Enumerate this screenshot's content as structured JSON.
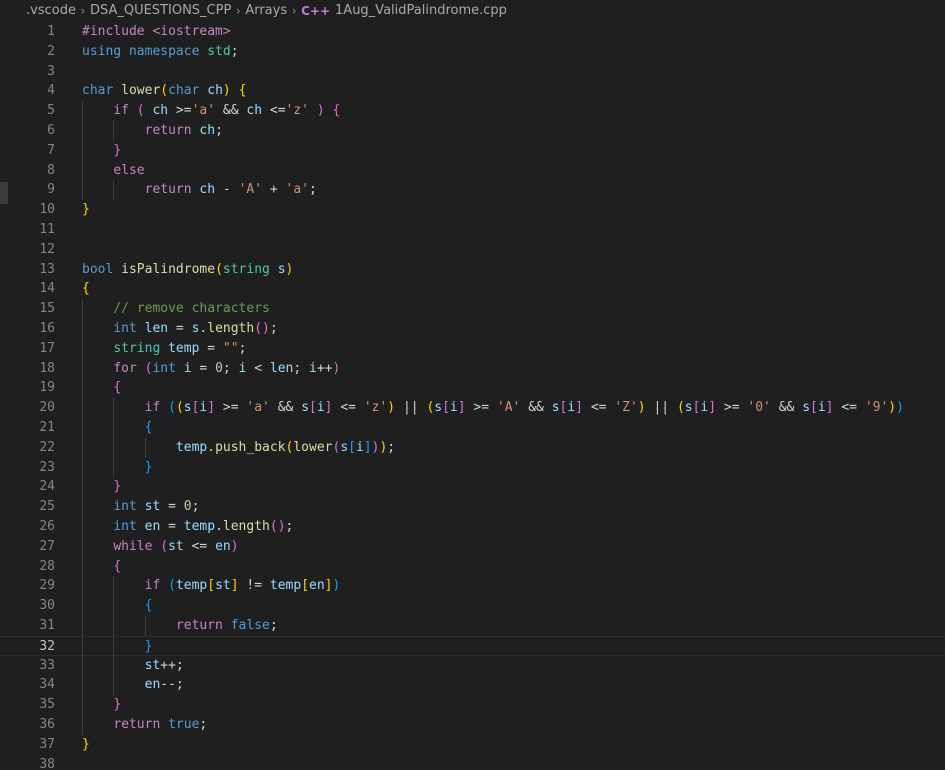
{
  "breadcrumb": {
    "items": [
      ".vscode",
      "DSA_QUESTIONS_CPP",
      "Arrays",
      "1Aug_ValidPalindrome.cpp"
    ],
    "separator": "›",
    "file_icon": "C++"
  },
  "editor": {
    "active_line": 32,
    "lines": [
      [
        [
          "#include <iostream>",
          "ctl"
        ]
      ],
      [
        [
          "using",
          "kw"
        ],
        [
          " ",
          "plain"
        ],
        [
          "namespace",
          "kw"
        ],
        [
          " ",
          "plain"
        ],
        [
          "std",
          "type"
        ],
        [
          ";",
          "plain"
        ]
      ],
      [],
      [
        [
          "char",
          "kw"
        ],
        [
          " ",
          "plain"
        ],
        [
          "lower",
          "fn"
        ],
        [
          "(",
          "br1"
        ],
        [
          "char",
          "kw"
        ],
        [
          " ",
          "plain"
        ],
        [
          "ch",
          "var"
        ],
        [
          ")",
          "br1"
        ],
        [
          " ",
          "plain"
        ],
        [
          "{",
          "br1"
        ]
      ],
      [
        [
          "    ",
          "plain"
        ],
        [
          "if",
          "ctl"
        ],
        [
          " ",
          "plain"
        ],
        [
          "(",
          "br2"
        ],
        [
          " ",
          "plain"
        ],
        [
          "ch",
          "var"
        ],
        [
          " >=",
          "plain"
        ],
        [
          "'a'",
          "str"
        ],
        [
          " && ",
          "plain"
        ],
        [
          "ch",
          "var"
        ],
        [
          " <=",
          "plain"
        ],
        [
          "'z'",
          "str"
        ],
        [
          " ",
          "plain"
        ],
        [
          ")",
          "br2"
        ],
        [
          " ",
          "plain"
        ],
        [
          "{",
          "br2"
        ]
      ],
      [
        [
          "        ",
          "plain"
        ],
        [
          "return",
          "ctl"
        ],
        [
          " ",
          "plain"
        ],
        [
          "ch",
          "var"
        ],
        [
          ";",
          "plain"
        ]
      ],
      [
        [
          "    ",
          "plain"
        ],
        [
          "}",
          "br2"
        ]
      ],
      [
        [
          "    ",
          "plain"
        ],
        [
          "else",
          "ctl"
        ]
      ],
      [
        [
          "        ",
          "plain"
        ],
        [
          "return",
          "ctl"
        ],
        [
          " ",
          "plain"
        ],
        [
          "ch",
          "var"
        ],
        [
          " - ",
          "plain"
        ],
        [
          "'A'",
          "str"
        ],
        [
          " + ",
          "plain"
        ],
        [
          "'a'",
          "str"
        ],
        [
          ";",
          "plain"
        ]
      ],
      [
        [
          "}",
          "br1"
        ]
      ],
      [],
      [],
      [
        [
          "bool",
          "kw"
        ],
        [
          " ",
          "plain"
        ],
        [
          "isPalindrome",
          "fn"
        ],
        [
          "(",
          "br1"
        ],
        [
          "string",
          "type"
        ],
        [
          " ",
          "plain"
        ],
        [
          "s",
          "var"
        ],
        [
          ")",
          "br1"
        ]
      ],
      [
        [
          "{",
          "br1"
        ]
      ],
      [
        [
          "    ",
          "plain"
        ],
        [
          "// remove characters",
          "cmt"
        ]
      ],
      [
        [
          "    ",
          "plain"
        ],
        [
          "int",
          "kw"
        ],
        [
          " ",
          "plain"
        ],
        [
          "len",
          "var"
        ],
        [
          " = ",
          "plain"
        ],
        [
          "s",
          "var"
        ],
        [
          ".",
          "plain"
        ],
        [
          "length",
          "fn"
        ],
        [
          "()",
          "br2"
        ],
        [
          ";",
          "plain"
        ]
      ],
      [
        [
          "    ",
          "plain"
        ],
        [
          "string",
          "type"
        ],
        [
          " ",
          "plain"
        ],
        [
          "temp",
          "var"
        ],
        [
          " = ",
          "plain"
        ],
        [
          "\"\"",
          "str"
        ],
        [
          ";",
          "plain"
        ]
      ],
      [
        [
          "    ",
          "plain"
        ],
        [
          "for",
          "ctl"
        ],
        [
          " ",
          "plain"
        ],
        [
          "(",
          "br2"
        ],
        [
          "int",
          "kw"
        ],
        [
          " ",
          "plain"
        ],
        [
          "i",
          "var"
        ],
        [
          " = ",
          "plain"
        ],
        [
          "0",
          "num"
        ],
        [
          "; ",
          "plain"
        ],
        [
          "i",
          "var"
        ],
        [
          " < ",
          "plain"
        ],
        [
          "len",
          "var"
        ],
        [
          "; ",
          "plain"
        ],
        [
          "i",
          "var"
        ],
        [
          "++",
          "plain"
        ],
        [
          ")",
          "br2"
        ]
      ],
      [
        [
          "    ",
          "plain"
        ],
        [
          "{",
          "br2"
        ]
      ],
      [
        [
          "        ",
          "plain"
        ],
        [
          "if",
          "ctl"
        ],
        [
          " ",
          "plain"
        ],
        [
          "(",
          "br3"
        ],
        [
          "(",
          "br1"
        ],
        [
          "s",
          "var"
        ],
        [
          "[",
          "br2"
        ],
        [
          "i",
          "var"
        ],
        [
          "]",
          "br2"
        ],
        [
          " >= ",
          "plain"
        ],
        [
          "'a'",
          "str"
        ],
        [
          " && ",
          "plain"
        ],
        [
          "s",
          "var"
        ],
        [
          "[",
          "br2"
        ],
        [
          "i",
          "var"
        ],
        [
          "]",
          "br2"
        ],
        [
          " <= ",
          "plain"
        ],
        [
          "'z'",
          "str"
        ],
        [
          ")",
          "br1"
        ],
        [
          " || ",
          "plain"
        ],
        [
          "(",
          "br1"
        ],
        [
          "s",
          "var"
        ],
        [
          "[",
          "br2"
        ],
        [
          "i",
          "var"
        ],
        [
          "]",
          "br2"
        ],
        [
          " >= ",
          "plain"
        ],
        [
          "'A'",
          "str"
        ],
        [
          " && ",
          "plain"
        ],
        [
          "s",
          "var"
        ],
        [
          "[",
          "br2"
        ],
        [
          "i",
          "var"
        ],
        [
          "]",
          "br2"
        ],
        [
          " <= ",
          "plain"
        ],
        [
          "'Z'",
          "str"
        ],
        [
          ")",
          "br1"
        ],
        [
          " || ",
          "plain"
        ],
        [
          "(",
          "br1"
        ],
        [
          "s",
          "var"
        ],
        [
          "[",
          "br2"
        ],
        [
          "i",
          "var"
        ],
        [
          "]",
          "br2"
        ],
        [
          " >= ",
          "plain"
        ],
        [
          "'0'",
          "str"
        ],
        [
          " && ",
          "plain"
        ],
        [
          "s",
          "var"
        ],
        [
          "[",
          "br2"
        ],
        [
          "i",
          "var"
        ],
        [
          "]",
          "br2"
        ],
        [
          " <= ",
          "plain"
        ],
        [
          "'9'",
          "str"
        ],
        [
          ")",
          "br1"
        ],
        [
          ")",
          "br3"
        ]
      ],
      [
        [
          "        ",
          "plain"
        ],
        [
          "{",
          "br3"
        ]
      ],
      [
        [
          "            ",
          "plain"
        ],
        [
          "temp",
          "var"
        ],
        [
          ".",
          "plain"
        ],
        [
          "push_back",
          "fn"
        ],
        [
          "(",
          "br1"
        ],
        [
          "lower",
          "fn"
        ],
        [
          "(",
          "br2"
        ],
        [
          "s",
          "var"
        ],
        [
          "[",
          "br3"
        ],
        [
          "i",
          "var"
        ],
        [
          "]",
          "br3"
        ],
        [
          ")",
          "br2"
        ],
        [
          ")",
          "br1"
        ],
        [
          ";",
          "plain"
        ]
      ],
      [
        [
          "        ",
          "plain"
        ],
        [
          "}",
          "br3"
        ]
      ],
      [
        [
          "    ",
          "plain"
        ],
        [
          "}",
          "br2"
        ]
      ],
      [
        [
          "    ",
          "plain"
        ],
        [
          "int",
          "kw"
        ],
        [
          " ",
          "plain"
        ],
        [
          "st",
          "var"
        ],
        [
          " = ",
          "plain"
        ],
        [
          "0",
          "num"
        ],
        [
          ";",
          "plain"
        ]
      ],
      [
        [
          "    ",
          "plain"
        ],
        [
          "int",
          "kw"
        ],
        [
          " ",
          "plain"
        ],
        [
          "en",
          "var"
        ],
        [
          " = ",
          "plain"
        ],
        [
          "temp",
          "var"
        ],
        [
          ".",
          "plain"
        ],
        [
          "length",
          "fn"
        ],
        [
          "()",
          "br2"
        ],
        [
          ";",
          "plain"
        ]
      ],
      [
        [
          "    ",
          "plain"
        ],
        [
          "while",
          "ctl"
        ],
        [
          " ",
          "plain"
        ],
        [
          "(",
          "br2"
        ],
        [
          "st",
          "var"
        ],
        [
          " <= ",
          "plain"
        ],
        [
          "en",
          "var"
        ],
        [
          ")",
          "br2"
        ]
      ],
      [
        [
          "    ",
          "plain"
        ],
        [
          "{",
          "br2"
        ]
      ],
      [
        [
          "        ",
          "plain"
        ],
        [
          "if",
          "ctl"
        ],
        [
          " ",
          "plain"
        ],
        [
          "(",
          "br3"
        ],
        [
          "temp",
          "var"
        ],
        [
          "[",
          "br1"
        ],
        [
          "st",
          "var"
        ],
        [
          "]",
          "br1"
        ],
        [
          " != ",
          "plain"
        ],
        [
          "temp",
          "var"
        ],
        [
          "[",
          "br1"
        ],
        [
          "en",
          "var"
        ],
        [
          "]",
          "br1"
        ],
        [
          ")",
          "br3"
        ]
      ],
      [
        [
          "        ",
          "plain"
        ],
        [
          "{",
          "br3"
        ]
      ],
      [
        [
          "            ",
          "plain"
        ],
        [
          "return",
          "ctl"
        ],
        [
          " ",
          "plain"
        ],
        [
          "false",
          "kw"
        ],
        [
          ";",
          "plain"
        ]
      ],
      [
        [
          "        ",
          "plain"
        ],
        [
          "}",
          "br3"
        ]
      ],
      [
        [
          "        ",
          "plain"
        ],
        [
          "st",
          "var"
        ],
        [
          "++;",
          "plain"
        ]
      ],
      [
        [
          "        ",
          "plain"
        ],
        [
          "en",
          "var"
        ],
        [
          "--;",
          "plain"
        ]
      ],
      [
        [
          "    ",
          "plain"
        ],
        [
          "}",
          "br2"
        ]
      ],
      [
        [
          "    ",
          "plain"
        ],
        [
          "return",
          "ctl"
        ],
        [
          " ",
          "plain"
        ],
        [
          "true",
          "kw"
        ],
        [
          ";",
          "plain"
        ]
      ],
      [
        [
          "}",
          "br1"
        ]
      ],
      []
    ]
  }
}
